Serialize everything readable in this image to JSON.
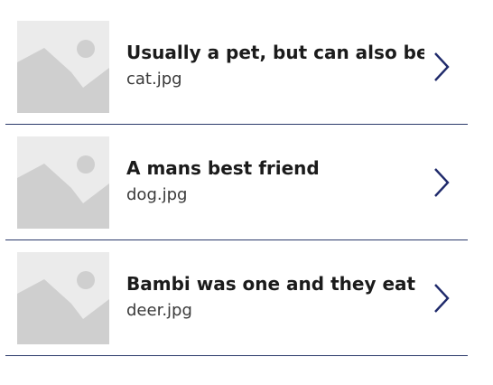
{
  "gallery": {
    "items": [
      {
        "title": "Usually a pet, but can also be a",
        "subtitle": "cat.jpg",
        "image_icon": "image-placeholder-icon",
        "nav_icon": "chevron-right-icon"
      },
      {
        "title": "A mans best friend",
        "subtitle": "dog.jpg",
        "image_icon": "image-placeholder-icon",
        "nav_icon": "chevron-right-icon"
      },
      {
        "title": "Bambi was one and they eat",
        "subtitle": "deer.jpg",
        "image_icon": "image-placeholder-icon",
        "nav_icon": "chevron-right-icon"
      }
    ]
  },
  "colors": {
    "separator": "#2b3a6b",
    "chevron": "#1f2a6b",
    "placeholder_bg": "#ebebeb",
    "placeholder_shape": "#cfcfcf"
  }
}
